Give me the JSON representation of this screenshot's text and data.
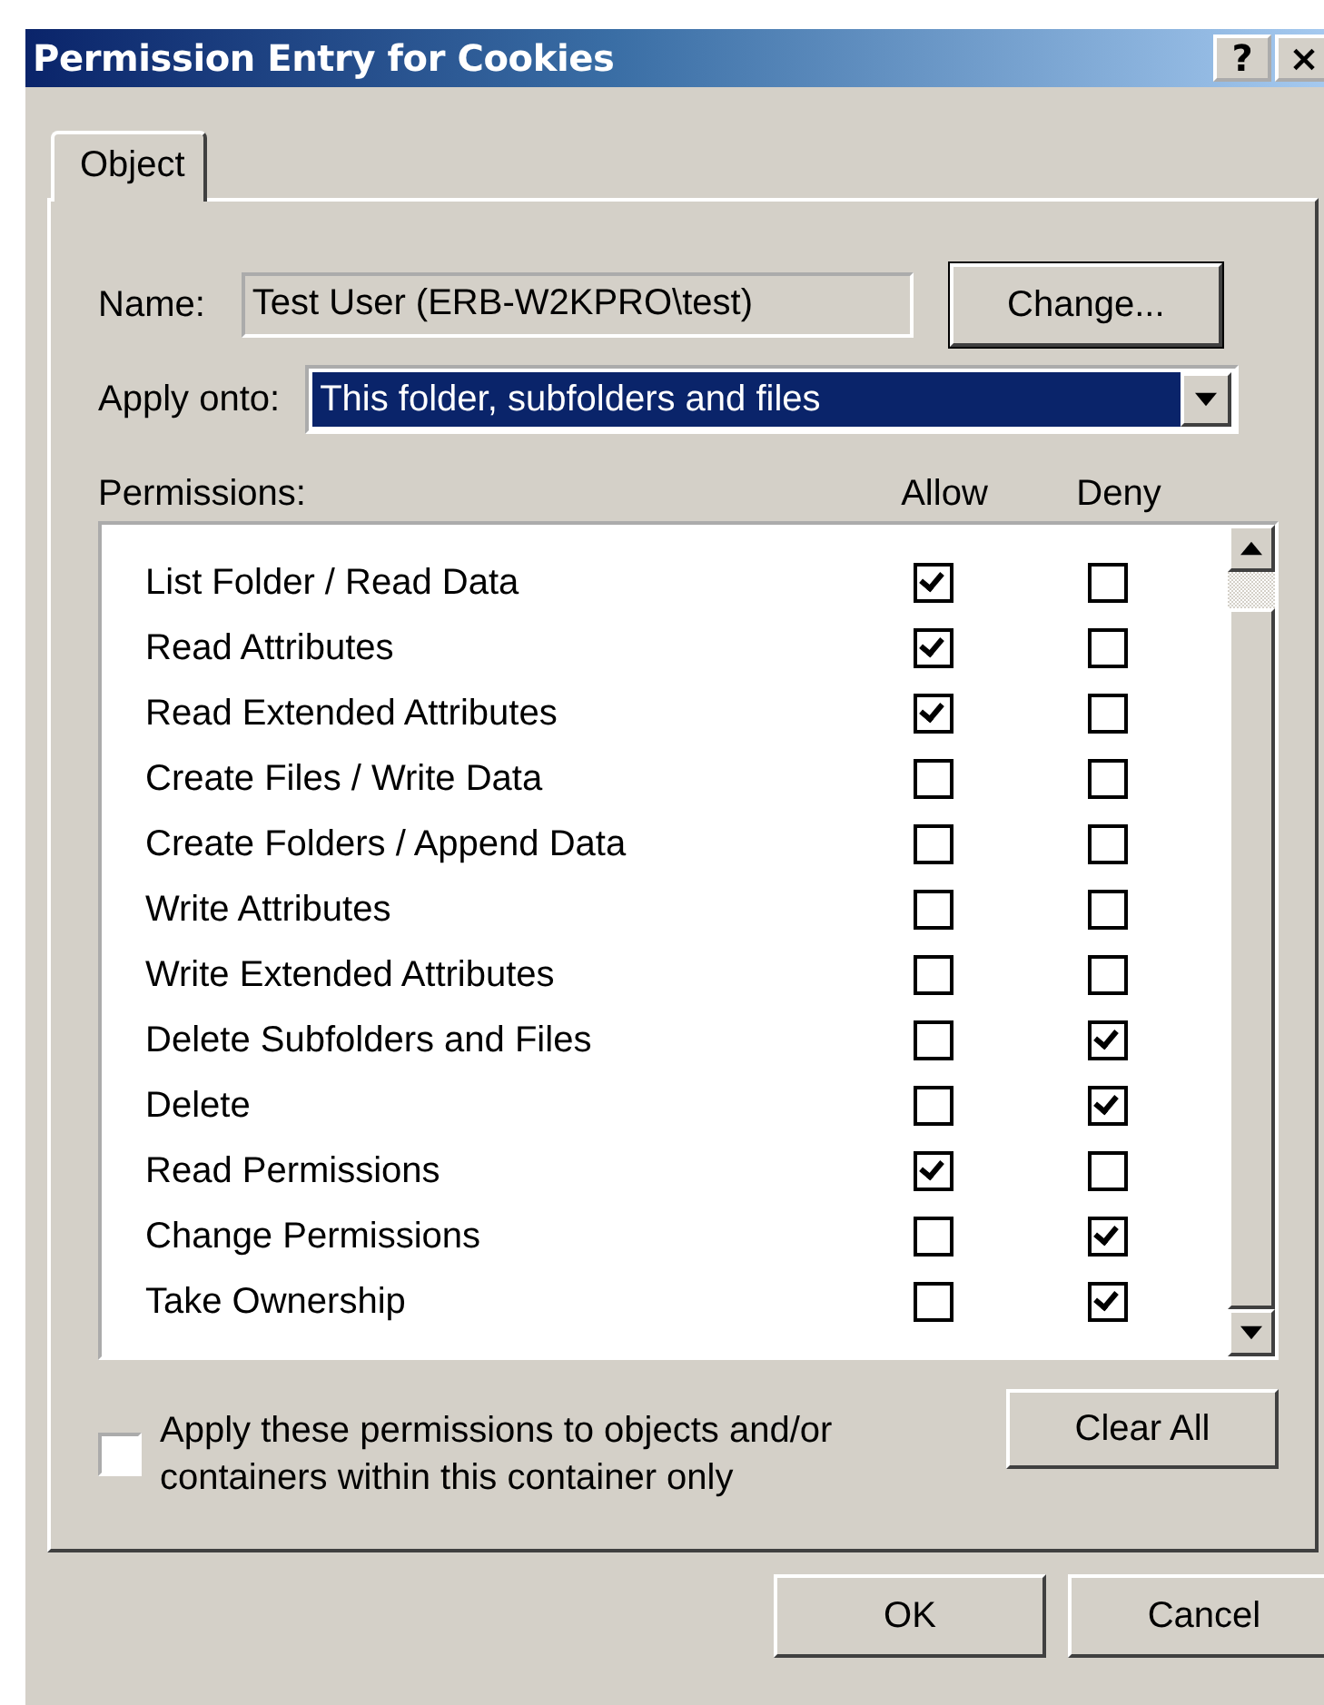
{
  "window": {
    "title": "Permission Entry for Cookies",
    "help_button": "?",
    "close_button": "×"
  },
  "tabs": [
    {
      "label": "Object",
      "selected": true
    }
  ],
  "name_label": "Name:",
  "name_value": "Test User (ERB-W2KPRO\\test)",
  "change_button": "Change...",
  "apply_onto": {
    "label": "Apply onto:",
    "value": "This folder, subfolders and files"
  },
  "permissions": {
    "label": "Permissions:",
    "columns": [
      "Allow",
      "Deny"
    ],
    "rows": [
      {
        "name": "List Folder / Read Data",
        "allow": true,
        "deny": false
      },
      {
        "name": "Read Attributes",
        "allow": true,
        "deny": false
      },
      {
        "name": "Read Extended Attributes",
        "allow": true,
        "deny": false
      },
      {
        "name": "Create Files / Write Data",
        "allow": false,
        "deny": false
      },
      {
        "name": "Create Folders / Append Data",
        "allow": false,
        "deny": false
      },
      {
        "name": "Write Attributes",
        "allow": false,
        "deny": false
      },
      {
        "name": "Write Extended Attributes",
        "allow": false,
        "deny": false
      },
      {
        "name": "Delete Subfolders and Files",
        "allow": false,
        "deny": true
      },
      {
        "name": "Delete",
        "allow": false,
        "deny": true
      },
      {
        "name": "Read Permissions",
        "allow": true,
        "deny": false
      },
      {
        "name": "Change Permissions",
        "allow": false,
        "deny": true
      },
      {
        "name": "Take Ownership",
        "allow": false,
        "deny": true
      }
    ]
  },
  "container_only": {
    "label": "Apply these permissions to objects and/or containers within this container only",
    "checked": false
  },
  "clear_all_button": "Clear All",
  "buttons": [
    "OK",
    "Cancel"
  ]
}
